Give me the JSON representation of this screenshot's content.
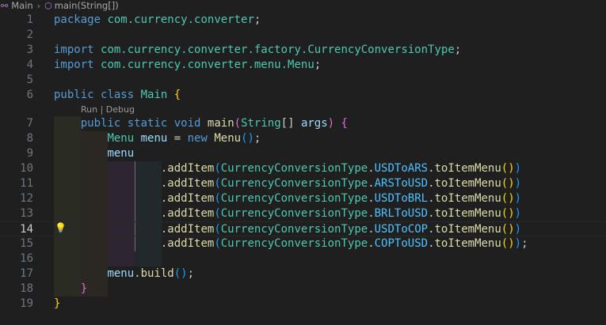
{
  "breadcrumb": {
    "file": "Main",
    "symbol": "main(String[])"
  },
  "codelens": {
    "run": "Run",
    "sep": " | ",
    "debug": "Debug"
  },
  "editor": {
    "active_line": 14,
    "lines": [
      {
        "n": "1",
        "tokens": [
          [
            "kw",
            "package"
          ],
          [
            "pl",
            " "
          ],
          [
            "ns",
            "com.currency.converter"
          ],
          [
            "pl",
            ";"
          ]
        ]
      },
      {
        "n": "2",
        "tokens": []
      },
      {
        "n": "3",
        "tokens": [
          [
            "kw",
            "import"
          ],
          [
            "pl",
            " "
          ],
          [
            "ns",
            "com.currency.converter.factory."
          ],
          [
            "ty",
            "CurrencyConversionType"
          ],
          [
            "pl",
            ";"
          ]
        ]
      },
      {
        "n": "4",
        "tokens": [
          [
            "kw",
            "import"
          ],
          [
            "pl",
            " "
          ],
          [
            "ns",
            "com.currency.converter.menu."
          ],
          [
            "ty",
            "Menu"
          ],
          [
            "pl",
            ";"
          ]
        ]
      },
      {
        "n": "5",
        "tokens": []
      },
      {
        "n": "6",
        "tokens": [
          [
            "kw",
            "public"
          ],
          [
            "pl",
            " "
          ],
          [
            "kw",
            "class"
          ],
          [
            "pl",
            " "
          ],
          [
            "ty",
            "Main"
          ],
          [
            "pl",
            " "
          ],
          [
            "b1",
            "{"
          ]
        ]
      },
      {
        "n": "7",
        "tokens": [
          [
            "pl",
            "    "
          ],
          [
            "kw",
            "public"
          ],
          [
            "pl",
            " "
          ],
          [
            "kw",
            "static"
          ],
          [
            "pl",
            " "
          ],
          [
            "kw",
            "void"
          ],
          [
            "pl",
            " "
          ],
          [
            "fn",
            "main"
          ],
          [
            "b2",
            "("
          ],
          [
            "ty",
            "String"
          ],
          [
            "pl",
            "[] "
          ],
          [
            "vr",
            "args"
          ],
          [
            "b2",
            ")"
          ],
          [
            "pl",
            " "
          ],
          [
            "b2",
            "{"
          ]
        ]
      },
      {
        "n": "8",
        "tokens": [
          [
            "pl",
            "        "
          ],
          [
            "ty",
            "Menu"
          ],
          [
            "pl",
            " "
          ],
          [
            "vr",
            "menu"
          ],
          [
            "pl",
            " = "
          ],
          [
            "kw",
            "new"
          ],
          [
            "pl",
            " "
          ],
          [
            "fn",
            "Menu"
          ],
          [
            "b3",
            "()"
          ],
          [
            "pl",
            ";"
          ]
        ]
      },
      {
        "n": "9",
        "tokens": [
          [
            "pl",
            "        "
          ],
          [
            "vr",
            "menu"
          ]
        ]
      },
      {
        "n": "10",
        "tokens": [
          [
            "pl",
            "                ."
          ],
          [
            "fn",
            "addItem"
          ],
          [
            "b3",
            "("
          ],
          [
            "ty",
            "CurrencyConversionType"
          ],
          [
            "pl",
            "."
          ],
          [
            "cn",
            "USDToARS"
          ],
          [
            "pl",
            "."
          ],
          [
            "fn",
            "toItemMenu"
          ],
          [
            "b1",
            "()"
          ],
          [
            "b3",
            ")"
          ]
        ]
      },
      {
        "n": "11",
        "tokens": [
          [
            "pl",
            "                ."
          ],
          [
            "fn",
            "addItem"
          ],
          [
            "b3",
            "("
          ],
          [
            "ty",
            "CurrencyConversionType"
          ],
          [
            "pl",
            "."
          ],
          [
            "cn",
            "ARSToUSD"
          ],
          [
            "pl",
            "."
          ],
          [
            "fn",
            "toItemMenu"
          ],
          [
            "b1",
            "()"
          ],
          [
            "b3",
            ")"
          ]
        ]
      },
      {
        "n": "12",
        "tokens": [
          [
            "pl",
            "                ."
          ],
          [
            "fn",
            "addItem"
          ],
          [
            "b3",
            "("
          ],
          [
            "ty",
            "CurrencyConversionType"
          ],
          [
            "pl",
            "."
          ],
          [
            "cn",
            "USDToBRL"
          ],
          [
            "pl",
            "."
          ],
          [
            "fn",
            "toItemMenu"
          ],
          [
            "b1",
            "()"
          ],
          [
            "b3",
            ")"
          ]
        ]
      },
      {
        "n": "13",
        "tokens": [
          [
            "pl",
            "                ."
          ],
          [
            "fn",
            "addItem"
          ],
          [
            "b3",
            "("
          ],
          [
            "ty",
            "CurrencyConversionType"
          ],
          [
            "pl",
            "."
          ],
          [
            "cn",
            "BRLToUSD"
          ],
          [
            "pl",
            "."
          ],
          [
            "fn",
            "toItemMenu"
          ],
          [
            "b1",
            "()"
          ],
          [
            "b3",
            ")"
          ]
        ]
      },
      {
        "n": "14",
        "tokens": [
          [
            "pl",
            "                ."
          ],
          [
            "fn",
            "addItem"
          ],
          [
            "b3",
            "("
          ],
          [
            "ty",
            "CurrencyConversionType"
          ],
          [
            "pl",
            "."
          ],
          [
            "cn",
            "USDToCOP"
          ],
          [
            "pl",
            "."
          ],
          [
            "fn",
            "toItemMenu"
          ],
          [
            "b1",
            "()"
          ],
          [
            "b3",
            ")"
          ]
        ]
      },
      {
        "n": "15",
        "tokens": [
          [
            "pl",
            "                ."
          ],
          [
            "fn",
            "addItem"
          ],
          [
            "b3",
            "("
          ],
          [
            "ty",
            "CurrencyConversionType"
          ],
          [
            "pl",
            "."
          ],
          [
            "cn",
            "COPToUSD"
          ],
          [
            "pl",
            "."
          ],
          [
            "fn",
            "toItemMenu"
          ],
          [
            "b1",
            "()"
          ],
          [
            "b3",
            ")"
          ],
          [
            "pl",
            ";"
          ]
        ]
      },
      {
        "n": "16",
        "tokens": []
      },
      {
        "n": "17",
        "tokens": [
          [
            "pl",
            "        "
          ],
          [
            "vr",
            "menu"
          ],
          [
            "pl",
            "."
          ],
          [
            "fn",
            "build"
          ],
          [
            "b3",
            "()"
          ],
          [
            "pl",
            ";"
          ]
        ]
      },
      {
        "n": "18",
        "tokens": [
          [
            "pl",
            "    "
          ],
          [
            "b2",
            "}"
          ]
        ]
      },
      {
        "n": "19",
        "tokens": [
          [
            "b1",
            "}"
          ]
        ]
      }
    ]
  },
  "colors": {
    "background": "#1f1f1f",
    "keyword": "#569cd6",
    "type": "#4ec9b0",
    "variable": "#9cdcfe",
    "function": "#dcdcaa",
    "constant": "#4fc1ff"
  }
}
